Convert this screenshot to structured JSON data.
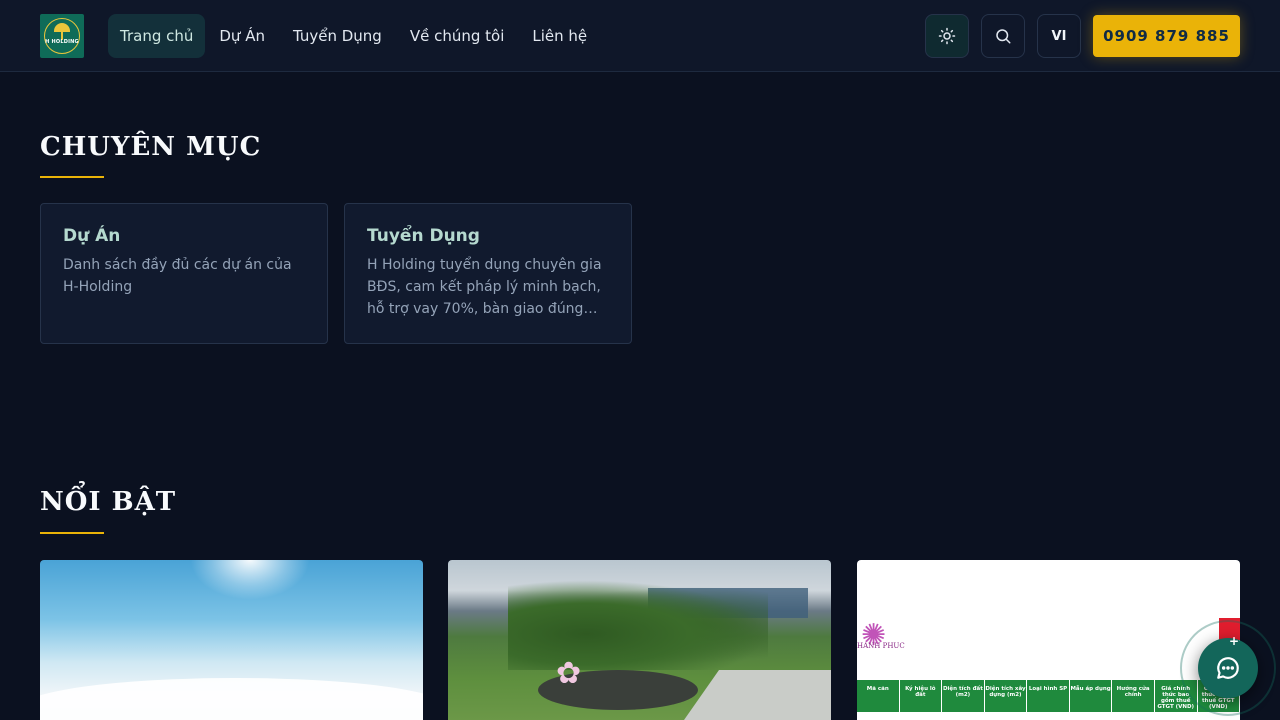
{
  "header": {
    "logo_text": "H HOLDING",
    "nav": [
      {
        "label": "Trang chủ",
        "active": true
      },
      {
        "label": "Dự Án",
        "active": false
      },
      {
        "label": "Tuyển Dụng",
        "active": false
      },
      {
        "label": "Về chúng tôi",
        "active": false
      },
      {
        "label": "Liên hệ",
        "active": false
      }
    ],
    "lang": "VI",
    "phone": "0909 879 885",
    "icons": {
      "theme": "sun-icon",
      "search": "search-icon"
    }
  },
  "categories": {
    "title": "CHUYÊN MỤC",
    "cards": [
      {
        "title": "Dự Án",
        "desc": "Danh sách đầy đủ các dự án của H-Holding"
      },
      {
        "title": "Tuyển Dụng",
        "desc": "H Holding tuyển dụng chuyên gia BĐS, cam kết pháp lý minh bạch, hỗ trợ vay 70%, bàn giao đúng tiến độ."
      }
    ]
  },
  "featured": {
    "title": "NỔI BẬT",
    "brand_text": "HANH PHUC",
    "table_headers": [
      "Mã căn",
      "Ký hiệu lô đất",
      "Diện tích đất (m2)",
      "Diện tích xây dựng (m2)",
      "Loại hình SP",
      "Mẫu áp dụng",
      "Hướng cửa chính",
      "Giá chính thức bao gồm thuế GTGT (VND)",
      "Giá chính thức CHƯA thuế GTGT (VND)"
    ]
  },
  "colors": {
    "accent": "#eab308",
    "background": "#0b1120",
    "card": "#111a2e",
    "chat": "#13665a"
  },
  "chat": {
    "icon": "chat-bubble-icon"
  }
}
